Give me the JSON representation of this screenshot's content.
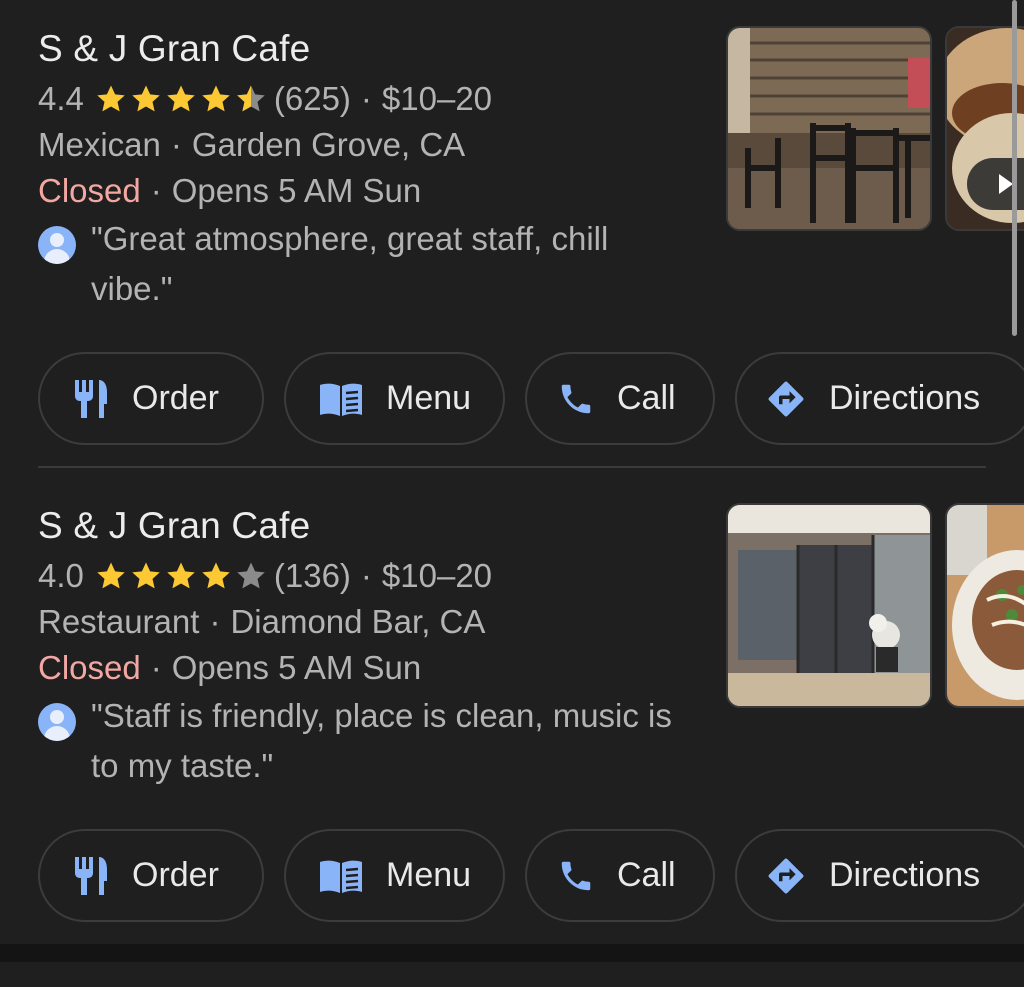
{
  "results": [
    {
      "name": "S & J Gran Cafe",
      "rating": "4.4",
      "rating_value": 4.4,
      "review_count": "(625)",
      "price": "$10–20",
      "category": "Mexican",
      "location": "Garden Grove, CA",
      "status": "Closed",
      "hours": "Opens 5 AM Sun",
      "review": "\"Great atmosphere, great staff, chill vibe.\"",
      "actions": {
        "order": "Order",
        "menu": "Menu",
        "call": "Call",
        "directions": "Directions"
      }
    },
    {
      "name": "S & J Gran Cafe",
      "rating": "4.0",
      "rating_value": 4.0,
      "review_count": "(136)",
      "price": "$10–20",
      "category": "Restaurant",
      "location": "Diamond Bar, CA",
      "status": "Closed",
      "hours": "Opens 5 AM Sun",
      "review": "\"Staff is friendly, place is clean, music is to my taste.\"",
      "actions": {
        "order": "Order",
        "menu": "Menu",
        "call": "Call",
        "directions": "Directions"
      }
    }
  ],
  "separator": "·",
  "colors": {
    "background": "#1f1f20",
    "star": "#fcc934",
    "closed": "#f2a7a2",
    "accent": "#8ab4f8"
  },
  "icons": {
    "order": "fork-knife-icon",
    "menu": "menu-book-icon",
    "call": "phone-icon",
    "directions": "directions-icon",
    "avatar": "user-avatar-icon",
    "play": "play-icon"
  }
}
